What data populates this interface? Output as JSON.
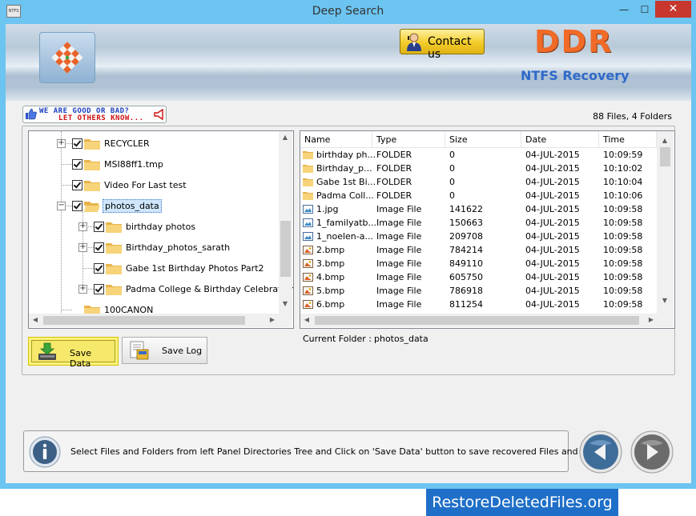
{
  "window": {
    "title": "Deep Search",
    "app_icon_text": "NTFS",
    "minimize_glyph": "—",
    "maximize_glyph": "☐",
    "close_glyph": "✕"
  },
  "banner": {
    "contact_label": "Contact us",
    "brand": "DDR",
    "product": "NTFS Recovery"
  },
  "feedback": {
    "line1": "WE ARE GOOD OR BAD?",
    "line2": "LET OTHERS KNOW..."
  },
  "counts": "88 Files, 4 Folders",
  "tree": {
    "items": [
      {
        "label": "RECYCLER",
        "level": 0,
        "expander": "+"
      },
      {
        "label": "MSI88ff1.tmp",
        "level": 0,
        "expander": ""
      },
      {
        "label": "Video For Last test",
        "level": 0,
        "expander": ""
      },
      {
        "label": "photos_data",
        "level": 0,
        "expander": "−",
        "selected": true
      },
      {
        "label": "birthday photos",
        "level": 1,
        "expander": "+"
      },
      {
        "label": "Birthday_photos_sarath",
        "level": 1,
        "expander": "+"
      },
      {
        "label": "Gabe 1st Birthday Photos Part2",
        "level": 1,
        "expander": ""
      },
      {
        "label": "Padma College & Birthday Celebration P",
        "level": 1,
        "expander": "+"
      },
      {
        "label": "100CANON",
        "level": 0,
        "expander": ""
      }
    ]
  },
  "list": {
    "columns": [
      "Name",
      "Type",
      "Size",
      "Date",
      "Time"
    ],
    "rows": [
      {
        "icon": "folder",
        "name": "birthday ph...",
        "type": "FOLDER",
        "size": "0",
        "date": "04-JUL-2015",
        "time": "10:09:59"
      },
      {
        "icon": "folder",
        "name": "Birthday_p...",
        "type": "FOLDER",
        "size": "0",
        "date": "04-JUL-2015",
        "time": "10:10:02"
      },
      {
        "icon": "folder",
        "name": "Gabe 1st Bi...",
        "type": "FOLDER",
        "size": "0",
        "date": "04-JUL-2015",
        "time": "10:10:04"
      },
      {
        "icon": "folder",
        "name": "Padma Coll...",
        "type": "FOLDER",
        "size": "0",
        "date": "04-JUL-2015",
        "time": "10:10:06"
      },
      {
        "icon": "image",
        "name": "1.jpg",
        "type": "Image File",
        "size": "141622",
        "date": "04-JUL-2015",
        "time": "10:09:58"
      },
      {
        "icon": "image",
        "name": "1_familyatb...",
        "type": "Image File",
        "size": "150663",
        "date": "04-JUL-2015",
        "time": "10:09:58"
      },
      {
        "icon": "image",
        "name": "1_noelen-a...",
        "type": "Image File",
        "size": "209708",
        "date": "04-JUL-2015",
        "time": "10:09:58"
      },
      {
        "icon": "bitmap",
        "name": "2.bmp",
        "type": "Image File",
        "size": "784214",
        "date": "04-JUL-2015",
        "time": "10:09:58"
      },
      {
        "icon": "bitmap",
        "name": "3.bmp",
        "type": "Image File",
        "size": "849110",
        "date": "04-JUL-2015",
        "time": "10:09:58"
      },
      {
        "icon": "bitmap",
        "name": "4.bmp",
        "type": "Image File",
        "size": "605750",
        "date": "04-JUL-2015",
        "time": "10:09:58"
      },
      {
        "icon": "bitmap",
        "name": "5.bmp",
        "type": "Image File",
        "size": "786918",
        "date": "04-JUL-2015",
        "time": "10:09:58"
      },
      {
        "icon": "bitmap",
        "name": "6.bmp",
        "type": "Image File",
        "size": "811254",
        "date": "04-JUL-2015",
        "time": "10:09:58"
      }
    ]
  },
  "current_folder": {
    "label": "Current Folder :",
    "value": "photos_data"
  },
  "buttons": {
    "save_data": "Save Data",
    "save_log": "Save Log"
  },
  "status": {
    "message": "Select Files and Folders from left Panel Directories Tree and Click on 'Save Data' button to save recovered Files and Folders."
  },
  "watermark": "RestoreDeletedFiles.org",
  "colors": {
    "window_frame": "#6cc4f0",
    "brand_orange": "#f06a28",
    "product_blue": "#2f69c8",
    "close_red": "#c7372d",
    "watermark_blue": "#1f6fc8"
  }
}
